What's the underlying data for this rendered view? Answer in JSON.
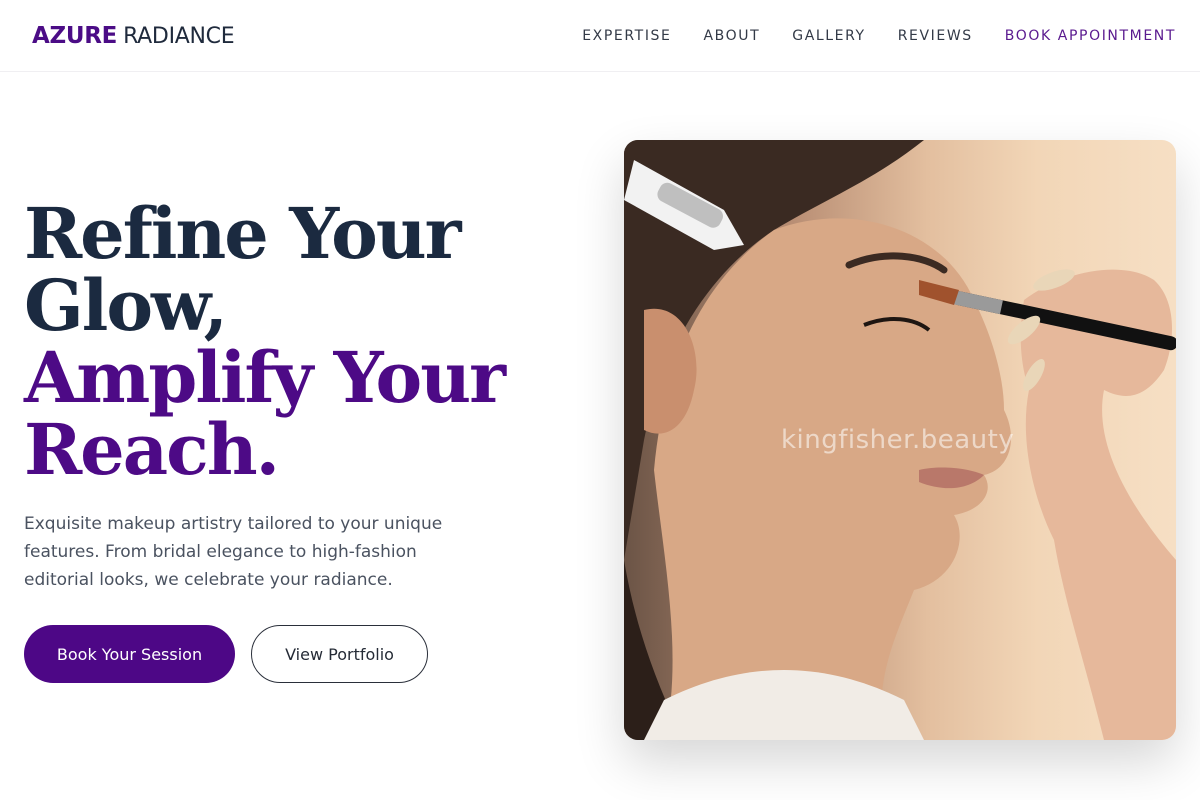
{
  "brand": {
    "name_bold": "AZURE",
    "name_light": "RADIANCE"
  },
  "nav": {
    "items": [
      "EXPERTISE",
      "ABOUT",
      "GALLERY",
      "REVIEWS"
    ],
    "cta": "BOOK APPOINTMENT"
  },
  "hero": {
    "title_line1": "Refine Your",
    "title_line2": "Glow,",
    "title_line3": "Amplify Your",
    "title_line4": "Reach.",
    "description": "Exquisite makeup artistry tailored to your unique features. From bridal elegance to high-fashion editorial looks, we celebrate your radiance.",
    "primary_button": "Book Your Session",
    "secondary_button": "View Portfolio"
  },
  "image": {
    "watermark": "kingfisher.beauty"
  },
  "colors": {
    "accent": "#4d0786",
    "dark": "#1b2a40",
    "text": "#4a5260"
  }
}
